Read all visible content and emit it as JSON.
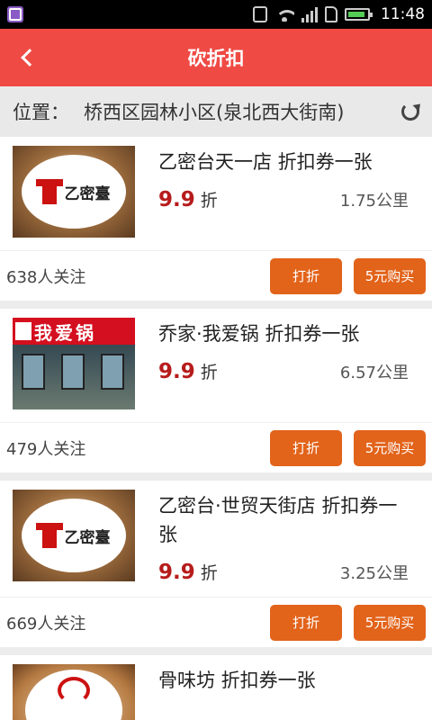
{
  "status_bar": {
    "time": "11:48",
    "network_tag_top": "4G",
    "network_tag_bottom": "2G"
  },
  "nav": {
    "title": "砍折扣"
  },
  "location": {
    "label": "位置：",
    "address": "桥西区园林小区(泉北西大街南)"
  },
  "items": [
    {
      "title": "乙密台天一店 折扣券一张",
      "discount": "9.9",
      "discount_unit": "折",
      "distance": "1.75公里",
      "followers": "638人关注",
      "bargain_label": "打折",
      "buy_label": "5元购买",
      "logo_text": "乙密臺"
    },
    {
      "title": "乔家·我爱锅 折扣券一张",
      "discount": "9.9",
      "discount_unit": "折",
      "distance": "6.57公里",
      "followers": "479人关注",
      "bargain_label": "打折",
      "buy_label": "5元购买",
      "sign_text": "我爱锅"
    },
    {
      "title": "乙密台·世贸天街店 折扣券一张",
      "discount": "9.9",
      "discount_unit": "折",
      "distance": "3.25公里",
      "followers": "669人关注",
      "bargain_label": "打折",
      "buy_label": "5元购买",
      "logo_text": "乙密臺"
    },
    {
      "title": "骨味坊 折扣券一张"
    }
  ]
}
